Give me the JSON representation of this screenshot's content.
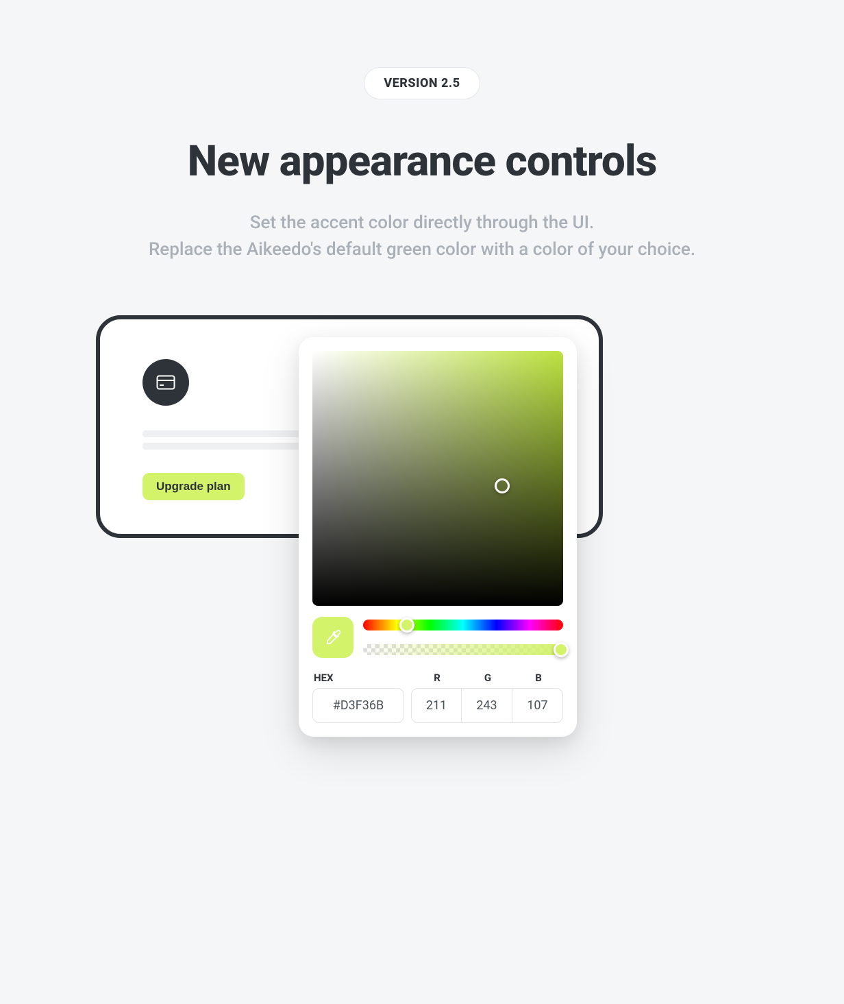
{
  "badge": {
    "text": "VERSION 2.5"
  },
  "heading": "New appearance controls",
  "subheading": "Set the accent color directly through the UI.\nReplace the Aikeedo's default green color with a color of your choice.",
  "card": {
    "button_label": "Upgrade plan"
  },
  "color_picker": {
    "accent_color": "#d3f36b",
    "labels": {
      "hex": "HEX",
      "r": "R",
      "g": "G",
      "b": "B"
    },
    "values": {
      "hex": "#D3F36B",
      "r": "211",
      "g": "243",
      "b": "107"
    }
  }
}
